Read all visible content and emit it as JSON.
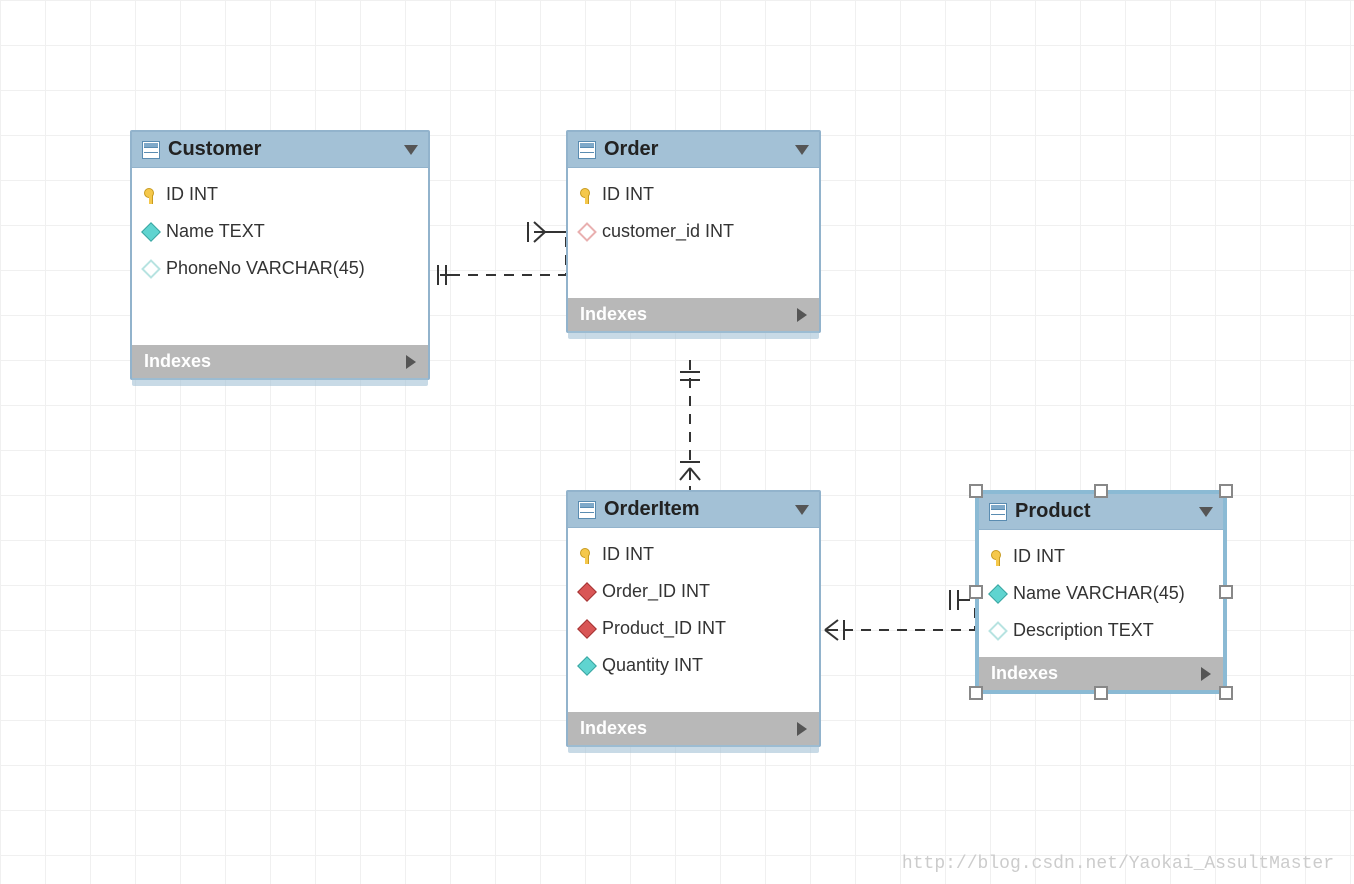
{
  "entities": {
    "customer": {
      "title": "Customer",
      "indexes_label": "Indexes",
      "columns": [
        {
          "label": "ID INT",
          "icon": "key"
        },
        {
          "label": "Name TEXT",
          "icon": "cyan-filled"
        },
        {
          "label": "PhoneNo VARCHAR(45)",
          "icon": "cyan-outline"
        }
      ]
    },
    "order": {
      "title": "Order",
      "indexes_label": "Indexes",
      "columns": [
        {
          "label": "ID INT",
          "icon": "key"
        },
        {
          "label": "customer_id INT",
          "icon": "pink-outline"
        }
      ]
    },
    "orderitem": {
      "title": "OrderItem",
      "indexes_label": "Indexes",
      "columns": [
        {
          "label": "ID INT",
          "icon": "key"
        },
        {
          "label": "Order_ID INT",
          "icon": "red-filled"
        },
        {
          "label": "Product_ID INT",
          "icon": "red-filled"
        },
        {
          "label": "Quantity INT",
          "icon": "cyan-filled"
        }
      ]
    },
    "product": {
      "title": "Product",
      "indexes_label": "Indexes",
      "columns": [
        {
          "label": "ID INT",
          "icon": "key"
        },
        {
          "label": "Name VARCHAR(45)",
          "icon": "cyan-filled"
        },
        {
          "label": "Description TEXT",
          "icon": "cyan-outline"
        }
      ]
    }
  },
  "watermark": "http://blog.csdn.net/Yaokai_AssultMaster"
}
